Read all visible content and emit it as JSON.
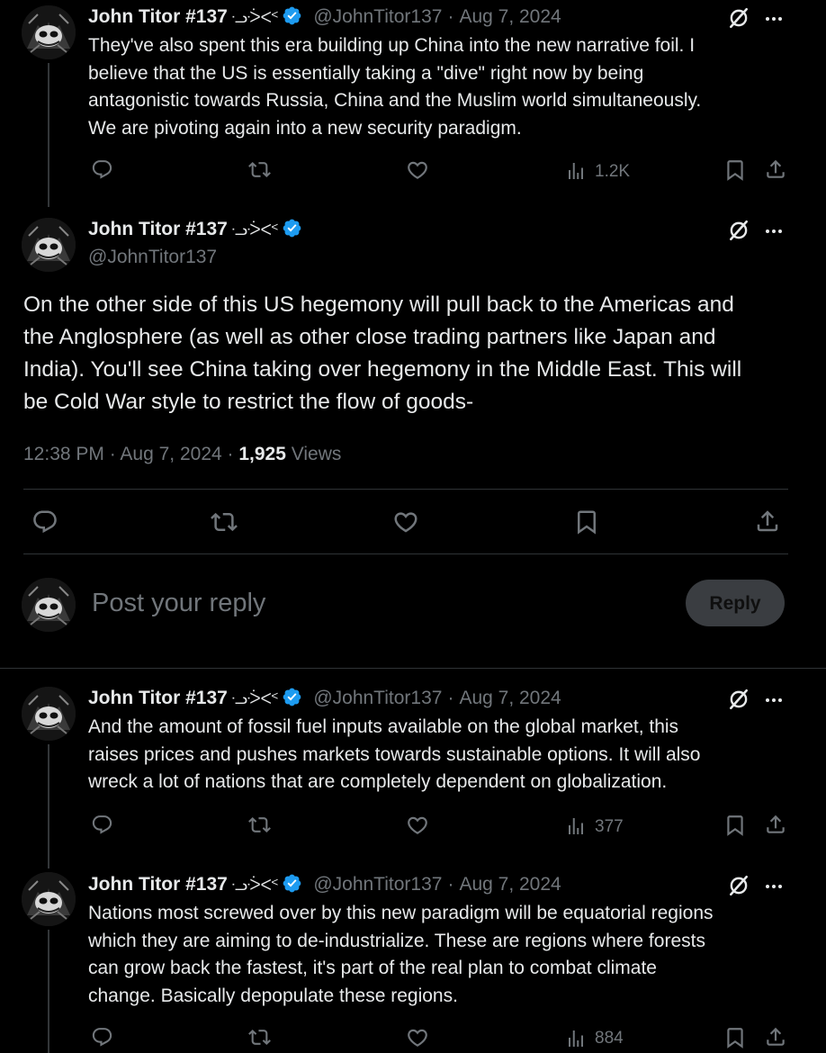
{
  "author": {
    "name": "John Titor #137",
    "glyphs": "ᓢᑂᐸᑉ",
    "handle": "@JohnTitor137",
    "verified": true
  },
  "colors": {
    "background": "#000000",
    "text": "#e7e9ea",
    "muted": "#71767b",
    "verified": "#1d9bf0",
    "divider": "#2f3336"
  },
  "tweets": [
    {
      "date": "Aug 7, 2024",
      "lines": [
        "They've also spent this era building up China into the new narrative foil. I",
        "believe that the US is essentially taking a \"dive\" right now by being",
        "antagonistic towards Russia, China and the Muslim world simultaneously.",
        "We are pivoting again into a new security paradigm."
      ],
      "views": "1.2K"
    },
    {
      "date": "Aug 7, 2024",
      "lines": [
        "And the amount of fossil fuel inputs available on the global market, this",
        "raises prices and pushes markets towards sustainable options. It will also",
        "wreck a lot of nations that are completely dependent on globalization."
      ],
      "views": "377"
    },
    {
      "date": "Aug 7, 2024",
      "lines": [
        "Nations most screwed over by this new paradigm will be equatorial regions",
        "which they are aiming to de-industrialize. These are regions where forests",
        "can grow back the fastest, it's part of the real plan to combat climate",
        "change. Basically depopulate these regions."
      ],
      "views": "884"
    }
  ],
  "main_tweet": {
    "lines": [
      "On the other side of this US hegemony will pull back to the Americas and",
      "the Anglosphere (as well as other close trading partners like Japan and",
      "India). You'll see China taking over hegemony in the Middle East. This will",
      "be Cold War style to restrict the flow of goods-"
    ],
    "time": "12:38 PM",
    "date": "Aug 7, 2024",
    "views_count": "1,925",
    "views_label": "Views"
  },
  "reply_box": {
    "placeholder": "Post your reply",
    "button_label": "Reply"
  },
  "icons": [
    "reply-icon",
    "retweet-icon",
    "like-icon",
    "views-icon",
    "bookmark-icon",
    "share-icon",
    "grok-icon",
    "more-icon",
    "verified-badge-icon"
  ]
}
